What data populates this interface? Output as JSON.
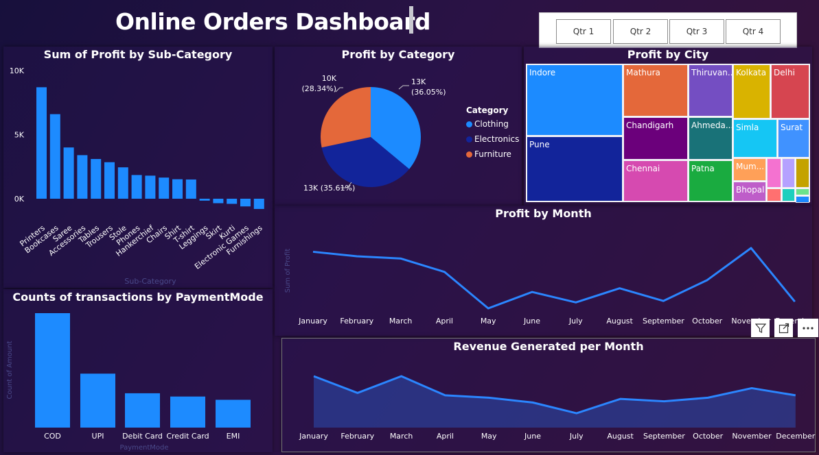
{
  "header": {
    "title": "Online Orders Dashboard"
  },
  "slicer": {
    "quarters": [
      "Qtr 1",
      "Qtr 2",
      "Qtr 3",
      "Qtr 4"
    ]
  },
  "colors": {
    "bar": "#1d8bff",
    "clothing": "#1c8bff",
    "electronics": "#12249a",
    "furniture": "#e4683a",
    "line": "#2b86ff"
  },
  "subcat_chart": {
    "title": "Sum of Profit by Sub-Category",
    "xlabel": "Sub-Category",
    "chart_data": {
      "type": "bar",
      "categories": [
        "Printers",
        "Bookcases",
        "Saree",
        "Accessories",
        "Tables",
        "Trousers",
        "Stole",
        "Phones",
        "Hankerchief",
        "Chairs",
        "Shirt",
        "T-shirt",
        "Leggings",
        "Skirt",
        "Kurti",
        "Electronic Games",
        "Furnishings"
      ],
      "values": [
        8700,
        6600,
        4000,
        3400,
        3100,
        2850,
        2450,
        1850,
        1800,
        1650,
        1520,
        1500,
        -150,
        -350,
        -400,
        -600,
        -800
      ],
      "yticks": [
        "10K",
        "5K",
        "0K"
      ],
      "ylim": [
        -1000,
        10000
      ]
    }
  },
  "category_chart": {
    "title": "Profit by Category",
    "legend_title": "Category",
    "legend": [
      "Clothing",
      "Electronics",
      "Furniture"
    ],
    "chart_data": {
      "type": "pie",
      "labels": [
        "Clothing",
        "Electronics",
        "Furniture"
      ],
      "values": [
        36.05,
        35.61,
        28.34
      ],
      "amounts": [
        "13K",
        "13K",
        "10K"
      ],
      "label_texts": [
        "13K",
        "(36.05%)",
        "13K (35.61%)",
        "10K",
        "(28.34%)"
      ]
    }
  },
  "city_chart": {
    "title": "Profit by City",
    "cities": [
      "Indore",
      "Pune",
      "Mathura",
      "Chandigarh",
      "Chennai",
      "Thiruvan...",
      "Ahmeda...",
      "Patna",
      "Kolkata",
      "Delhi",
      "Simla",
      "Surat",
      "Mum...",
      "Bhopal"
    ]
  },
  "month_chart": {
    "title": "Profit by Month",
    "ylabel": "Sum of Profit",
    "chart_data": {
      "type": "line",
      "x": [
        "January",
        "February",
        "March",
        "April",
        "May",
        "June",
        "July",
        "August",
        "September",
        "October",
        "November",
        "December"
      ],
      "y": [
        5100,
        4800,
        4650,
        3750,
        1300,
        2400,
        1700,
        2650,
        1800,
        3200,
        5350,
        1750
      ]
    }
  },
  "payment_chart": {
    "title": "Counts of transactions by PaymentMode",
    "ylabel": "Count of Amount",
    "xlabel": "PaymentMode",
    "chart_data": {
      "type": "bar",
      "categories": [
        "COD",
        "UPI",
        "Debit Card",
        "Credit Card",
        "EMI"
      ],
      "values": [
        700,
        330,
        210,
        190,
        170
      ]
    }
  },
  "revenue_chart": {
    "title": "Revenue Generated per Month",
    "xlabel": "Month",
    "chart_data": {
      "type": "area",
      "x": [
        "January",
        "February",
        "March",
        "April",
        "May",
        "June",
        "July",
        "August",
        "September",
        "October",
        "November",
        "December"
      ],
      "y": [
        43000,
        29000,
        43000,
        27000,
        25000,
        21000,
        12000,
        24000,
        22000,
        25000,
        33000,
        27000
      ]
    }
  },
  "toolbar": {
    "filter_icon": "filter-icon",
    "focus_icon": "focus-mode-icon",
    "more_icon": "more-options-icon"
  }
}
